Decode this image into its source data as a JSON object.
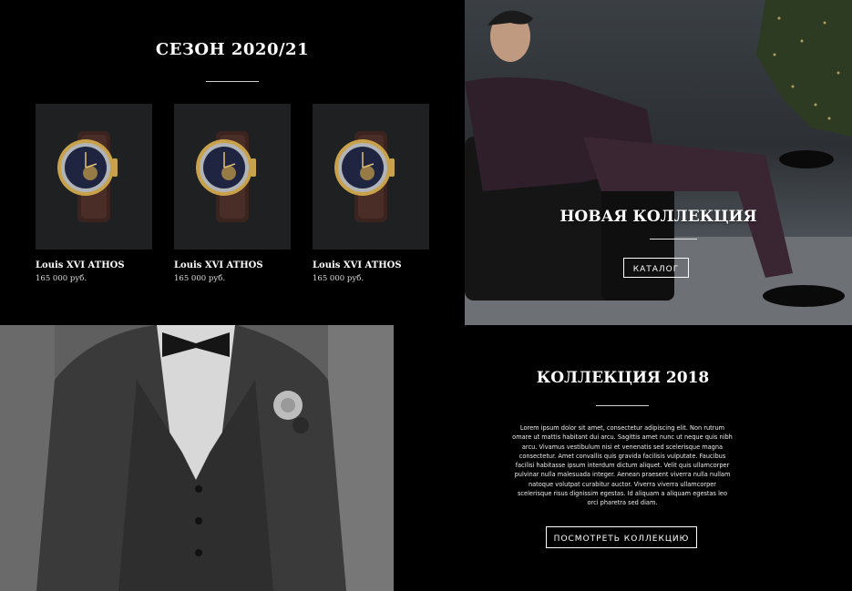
{
  "season": {
    "title": "СЕЗОН 2020/21",
    "products": [
      {
        "name": "Louis XVI ATHOS",
        "price": "165 000 руб."
      },
      {
        "name": "Louis XVI ATHOS",
        "price": "165 000 руб."
      },
      {
        "name": "Louis XVI ATHOS",
        "price": "165 000 руб."
      }
    ]
  },
  "hero": {
    "title": "НОВАЯ КОЛЛЕКЦИЯ",
    "button": "КАТАЛОГ"
  },
  "collection": {
    "title": "КОЛЛЕКЦИЯ 2018",
    "text": "Lorem ipsum dolor sit amet, consectetur adipiscing elit. Non rutrum omare ut mattis habitant dui arcu. Sagittis amet nunc ut neque quis nibh arcu. Vivamus vestibulum nisi et venenatis sed scelerisque magna consectetur. Amet convallis quis gravida facilisis vulputate. Faucibus facilisi habitasse ipsum interdum dictum aliquet. Velit quis ullamcorper pulvinar nulla malesuada integer. Aenean praesent viverra nulla nullam natoque volutpat curabitur auctor. Viverra viverra ullamcorper scelerisque risus dignissim egestas. Id aliquam a aliquam egestas leo orci pharetra sed diam.",
    "button": "ПОСМОТРЕТЬ КОЛЛЕКЦИЮ"
  },
  "colors": {
    "background": "#000000",
    "tile": "#1f2022",
    "text": "#ffffff"
  }
}
